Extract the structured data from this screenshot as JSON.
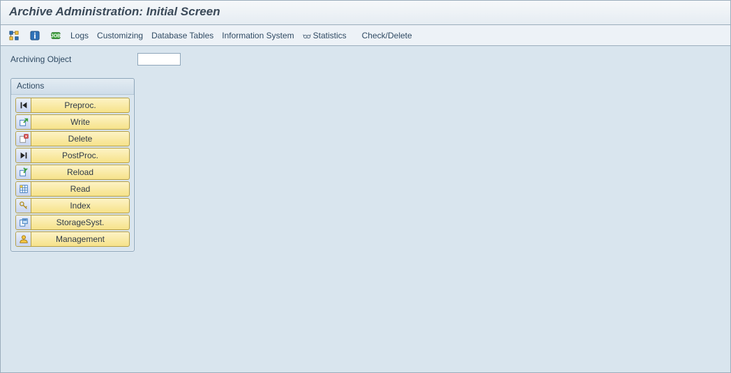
{
  "title": "Archive Administration: Initial Screen",
  "toolbar": {
    "menu": {
      "logs": "Logs",
      "customizing": "Customizing",
      "db_tables": "Database Tables",
      "info_system": "Information System",
      "statistics": "Statistics",
      "check_delete": "Check/Delete"
    }
  },
  "field": {
    "archiving_object_label": "Archiving Object",
    "archiving_object_value": ""
  },
  "actions": {
    "header": "Actions",
    "items": {
      "preproc": "Preproc.",
      "write": "Write",
      "delete": "Delete",
      "postproc": "PostProc.",
      "reload": "Reload",
      "read": "Read",
      "index": "Index",
      "storagesyst": "StorageSyst.",
      "management": "Management"
    }
  }
}
